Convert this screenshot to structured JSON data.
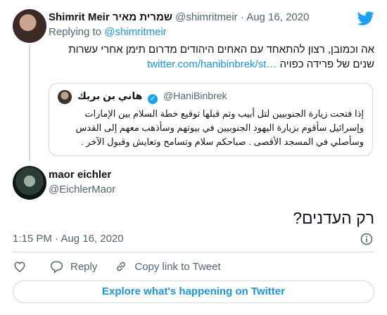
{
  "parent": {
    "name": "Shimrit Meir שמרית מאיר",
    "handle": "@shimritmeir",
    "separator": "·",
    "date": "Aug 16, 2020",
    "replying_prefix": "Replying to",
    "replying_handle": "@shimritmeir",
    "text": "אה וכמובן, רצון להתאחד עם האחים היהודים מדרום תימן אחרי עשרות שנים של פרידה כפויה",
    "link": "twitter.com/hanibinbrek/st…"
  },
  "quoted": {
    "name": "هاني بن بريك",
    "handle": "@HaniBinbrek",
    "text": "إذا فتحت زيارة الجنوبيين لتل أبيب وتم قبلها توقيع خطة السلام بين الإمارات وإسرائيل سأقوم بزيارة اليهود الجنوبيين في بيوتهم وسأذهب معهم إلى القدس وسأصلي في المسجد الأقصى . صباحكم سلام وتسامح وتعايش وقبول الآخر ."
  },
  "main": {
    "name": "maor eichler",
    "handle": "@EichlerMaor",
    "text": "רק העדנים?",
    "time": "1:15 PM",
    "separator": "·",
    "date": "Aug 16, 2020"
  },
  "actions": {
    "reply": "Reply",
    "copy_link": "Copy link to Tweet"
  },
  "explore_label": "Explore what's happening on Twitter",
  "colors": {
    "accent": "#1b95e0",
    "muted": "#536471",
    "border": "#cfd9de",
    "twitter_blue": "#1da1f2"
  },
  "icons": [
    "twitter-bird-icon",
    "verified-icon",
    "info-icon",
    "heart-icon",
    "reply-icon",
    "link-icon"
  ]
}
